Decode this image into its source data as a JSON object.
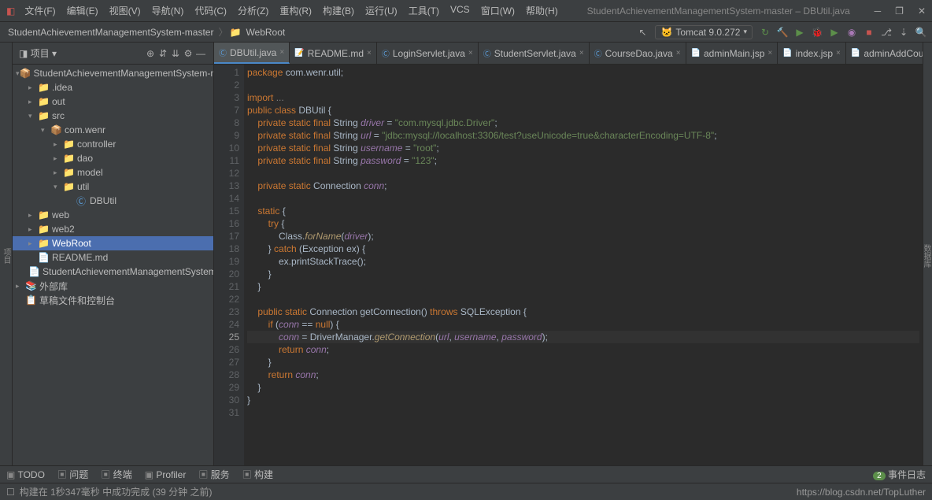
{
  "window": {
    "title": "StudentAchievementManagementSystem-master – DBUtil.java"
  },
  "menu": [
    "文件(F)",
    "编辑(E)",
    "视图(V)",
    "导航(N)",
    "代码(C)",
    "分析(Z)",
    "重构(R)",
    "构建(B)",
    "运行(U)",
    "工具(T)",
    "VCS",
    "窗口(W)",
    "帮助(H)"
  ],
  "breadcrumb": {
    "project": "StudentAchievementManagementSystem-master",
    "folder": "WebRoot"
  },
  "run_config": "Tomcat 9.0.272",
  "sidebar": {
    "header": "项目",
    "tree": [
      {
        "ind": 0,
        "chev": "▾",
        "icon": "📦",
        "label": "StudentAchievementManagementSystem-master",
        "cls": ""
      },
      {
        "ind": 1,
        "chev": "▸",
        "icon": "📁",
        "label": ".idea",
        "cls": "folder-orange"
      },
      {
        "ind": 1,
        "chev": "▸",
        "icon": "📁",
        "label": "out",
        "cls": "folder-orange",
        "style": "color:#c75450"
      },
      {
        "ind": 1,
        "chev": "▾",
        "icon": "📁",
        "label": "src",
        "cls": "folder-blue"
      },
      {
        "ind": 2,
        "chev": "▾",
        "icon": "📦",
        "label": "com.wenr",
        "cls": ""
      },
      {
        "ind": 3,
        "chev": "▸",
        "icon": "📁",
        "label": "controller",
        "cls": ""
      },
      {
        "ind": 3,
        "chev": "▸",
        "icon": "📁",
        "label": "dao",
        "cls": ""
      },
      {
        "ind": 3,
        "chev": "▸",
        "icon": "📁",
        "label": "model",
        "cls": ""
      },
      {
        "ind": 3,
        "chev": "▾",
        "icon": "📁",
        "label": "util",
        "cls": ""
      },
      {
        "ind": 4,
        "chev": "",
        "icon": "Ⓒ",
        "label": "DBUtil",
        "cls": "blue"
      },
      {
        "ind": 1,
        "chev": "▸",
        "icon": "📁",
        "label": "web",
        "cls": ""
      },
      {
        "ind": 1,
        "chev": "▸",
        "icon": "📁",
        "label": "web2",
        "cls": ""
      },
      {
        "ind": 1,
        "chev": "▸",
        "icon": "📁",
        "label": "WebRoot",
        "cls": "",
        "selected": true
      },
      {
        "ind": 1,
        "chev": "",
        "icon": "📄",
        "label": "README.md",
        "cls": ""
      },
      {
        "ind": 1,
        "chev": "",
        "icon": "📄",
        "label": "StudentAchievementManagementSystem-mas",
        "cls": ""
      },
      {
        "ind": 0,
        "chev": "▸",
        "icon": "📚",
        "label": "外部库",
        "cls": ""
      },
      {
        "ind": 0,
        "chev": "",
        "icon": "📋",
        "label": "草稿文件和控制台",
        "cls": "orange"
      }
    ]
  },
  "tabs": [
    {
      "label": "DBUtil.java",
      "icon": "Ⓒ",
      "active": true,
      "color": "blue"
    },
    {
      "label": "README.md",
      "icon": "📝",
      "color": "blue"
    },
    {
      "label": "LoginServlet.java",
      "icon": "Ⓒ",
      "color": "blue"
    },
    {
      "label": "StudentServlet.java",
      "icon": "Ⓒ",
      "color": "blue"
    },
    {
      "label": "CourseDao.java",
      "icon": "Ⓒ",
      "color": "blue"
    },
    {
      "label": "adminMain.jsp",
      "icon": "📄",
      "color": "orange"
    },
    {
      "label": "index.jsp",
      "icon": "📄",
      "color": "orange"
    },
    {
      "label": "adminAddCourse.jsp",
      "icon": "📄",
      "color": "orange"
    }
  ],
  "code": {
    "lines": [
      {
        "n": 1,
        "html": "<span class='kw'>package</span> com.wenr.util;"
      },
      {
        "n": 2,
        "html": ""
      },
      {
        "n": 3,
        "html": "<span class='kw'>import</span> <span class='comment'>...</span>"
      },
      {
        "n": 4,
        "html": "",
        "skip": true
      },
      {
        "n": 5,
        "html": "",
        "skip": true
      },
      {
        "n": 6,
        "html": "",
        "skip": true
      },
      {
        "n": 7,
        "html": "<span class='kw'>public class</span> DBUtil {"
      },
      {
        "n": 8,
        "html": "    <span class='kw'>private static final</span> String <span class='field'>driver</span> = <span class='str'>\"com.mysql.jdbc.Driver\"</span>;"
      },
      {
        "n": 9,
        "html": "    <span class='kw'>private static final</span> String <span class='field'>url</span> = <span class='str'>\"jdbc:mysql://localhost:3306/test?useUnicode=true&characterEncoding=UTF-8\"</span>;"
      },
      {
        "n": 10,
        "html": "    <span class='kw'>private static final</span> String <span class='field'>username</span> = <span class='str'>\"root\"</span>;"
      },
      {
        "n": 11,
        "html": "    <span class='kw'>private static final</span> String <span class='field'>password</span> = <span class='str'>\"123\"</span>;"
      },
      {
        "n": 12,
        "html": ""
      },
      {
        "n": 13,
        "html": "    <span class='kw'>private static</span> Connection <span class='field'>conn</span>;"
      },
      {
        "n": 14,
        "html": ""
      },
      {
        "n": 15,
        "html": "    <span class='kw'>static</span> {"
      },
      {
        "n": 16,
        "html": "        <span class='kw'>try</span> {"
      },
      {
        "n": 17,
        "html": "            Class.<span class='method-i'>forName</span>(<span class='field'>driver</span>);"
      },
      {
        "n": 18,
        "html": "        } <span class='kw'>catch</span> (Exception ex) {"
      },
      {
        "n": 19,
        "html": "            ex.printStackTrace();"
      },
      {
        "n": 20,
        "html": "        }"
      },
      {
        "n": 21,
        "html": "    }"
      },
      {
        "n": 22,
        "html": ""
      },
      {
        "n": 23,
        "html": "    <span class='kw'>public static</span> Connection getConnection() <span class='kw'>throws</span> SQLException {"
      },
      {
        "n": 24,
        "html": "        <span class='kw'>if</span> (<span class='field'>conn</span> == <span class='kw'>null</span>) {"
      },
      {
        "n": 25,
        "html": "            <span class='field'>conn</span> = DriverManager.<span class='method-i'>getConnection</span>(<span class='field'>url</span>, <span class='field'>username</span>, <span class='field'>password</span>);",
        "current": true
      },
      {
        "n": 26,
        "html": "            <span class='kw'>return</span> <span class='field'>conn</span>;"
      },
      {
        "n": 27,
        "html": "        }"
      },
      {
        "n": 28,
        "html": "        <span class='kw'>return</span> <span class='field'>conn</span>;"
      },
      {
        "n": 29,
        "html": "    }"
      },
      {
        "n": 30,
        "html": "}"
      },
      {
        "n": 31,
        "html": ""
      }
    ]
  },
  "bottom_tabs": [
    "TODO",
    "问题",
    "终端",
    "Profiler",
    "服务",
    "构建"
  ],
  "status": {
    "left": "构建在 1秒347毫秒 中成功完成 (39 分钟 之前)",
    "events_count": "2",
    "events_label": "事件日志",
    "watermark": "https://blog.csdn.net/TopLuther"
  },
  "left_strip": "项目",
  "right_strip": "数据库"
}
